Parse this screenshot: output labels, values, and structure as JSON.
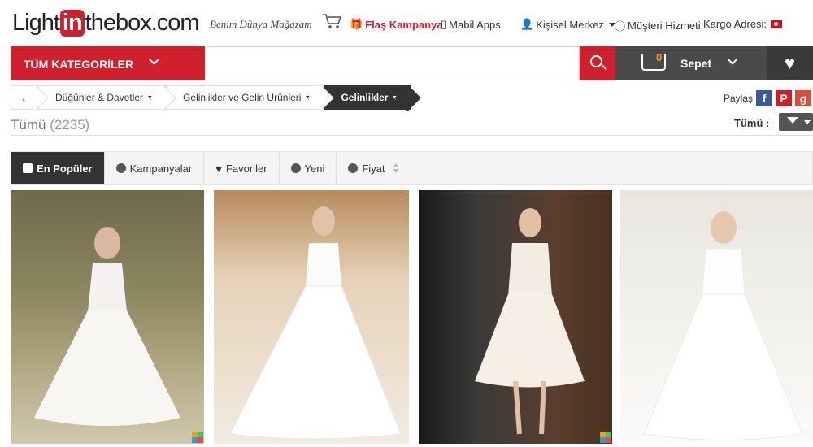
{
  "header": {
    "logo_pre": "Light",
    "logo_in": "in",
    "logo_post": "thebox.com",
    "tagline": "Benim Dünya Mağazam",
    "flash_label": "Flaş Kampanya",
    "apps_label": "Mabil Apps",
    "account_label": "Kişisel Merkez",
    "help_label": "Müşteri Hizmeti",
    "ship_label": "Kargo Adresi:"
  },
  "nav": {
    "categories_label": "TÜM KATEGORİLER",
    "search_placeholder": "",
    "cart_count": "0",
    "cart_label": "Sepet"
  },
  "breadcrumb": {
    "items": [
      "Düğünler & Davetler",
      "Gelinlikler ve Gelin Ürünleri",
      "Gelinlikler"
    ]
  },
  "share": {
    "label": "Paylaş"
  },
  "listing": {
    "all_label": "Tümü",
    "count": "(2235)",
    "filter_label": "Tümü :"
  },
  "sort": {
    "tabs": [
      "En Popüler",
      "Kampanyalar",
      "Favoriler",
      "Yeni",
      "Fiyat"
    ]
  },
  "colors": {
    "brand_red": "#d0202e",
    "dark": "#333333",
    "cart_bg": "#4a4a4a"
  }
}
